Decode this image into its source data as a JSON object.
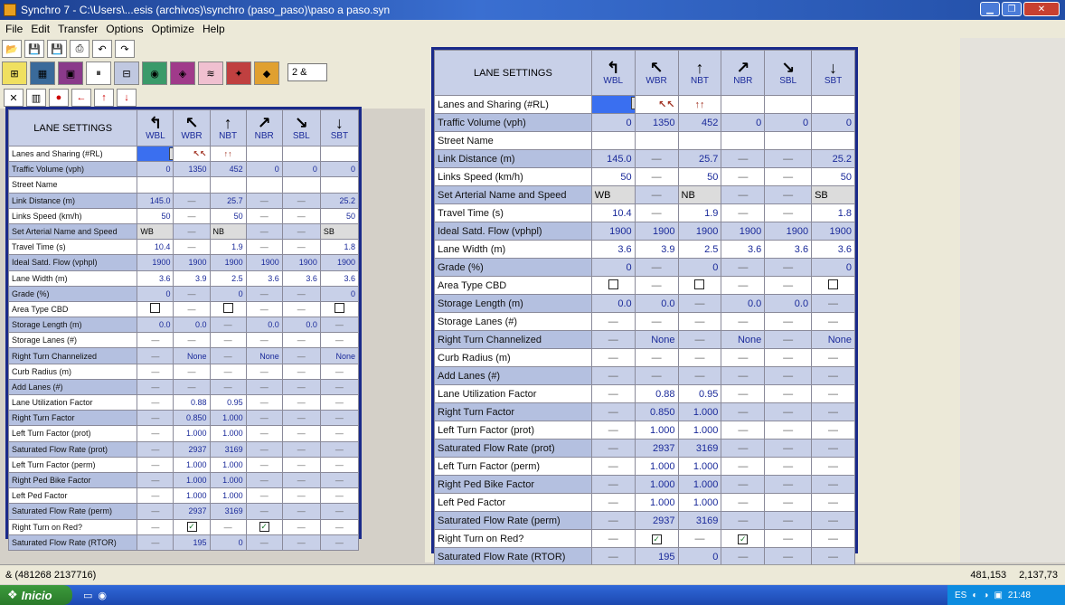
{
  "window": {
    "title": "Synchro 7 - C:\\Users\\...esis (archivos)\\synchro (paso_paso)\\paso a paso.syn",
    "controls": [
      "min-icon",
      "max-icon",
      "close-icon"
    ]
  },
  "menu": [
    "File",
    "Edit",
    "Transfer",
    "Options",
    "Optimize",
    "Help"
  ],
  "toolbar": {
    "zone_value": "2 &"
  },
  "lane_settings": {
    "header_label": "LANE SETTINGS",
    "movements": [
      {
        "code": "WBL",
        "arrow": "↰"
      },
      {
        "code": "WBR",
        "arrow": "↖"
      },
      {
        "code": "NBT",
        "arrow": "↑"
      },
      {
        "code": "NBR",
        "arrow": "↗"
      },
      {
        "code": "SBL",
        "arrow": "↘"
      },
      {
        "code": "SBT",
        "arrow": "↓"
      }
    ],
    "lanes_label": "Lanes and Sharing (#RL)",
    "wbr_lane_symbol": "↖↖",
    "nbt_lane_symbol": "↑↑",
    "rows": [
      {
        "label": "Traffic Volume (vph)",
        "values": [
          "0",
          "1350",
          "452",
          "0",
          "0",
          "0"
        ]
      },
      {
        "label": "Street Name",
        "values": [
          "",
          "",
          "",
          "",
          "",
          ""
        ]
      },
      {
        "label": "Link Distance (m)",
        "values": [
          "145.0",
          "—",
          "25.7",
          "—",
          "—",
          "25.2"
        ]
      },
      {
        "label": "Links Speed (km/h)",
        "values": [
          "50",
          "—",
          "50",
          "—",
          "—",
          "50"
        ]
      },
      {
        "label": "Set Arterial Name and Speed",
        "values": [
          "WB",
          "—",
          "NB",
          "—",
          "—",
          "SB"
        ]
      },
      {
        "label": "Travel Time (s)",
        "values": [
          "10.4",
          "—",
          "1.9",
          "—",
          "—",
          "1.8"
        ]
      },
      {
        "label": "Ideal Satd. Flow (vphpl)",
        "values": [
          "1900",
          "1900",
          "1900",
          "1900",
          "1900",
          "1900"
        ]
      },
      {
        "label": "Lane Width (m)",
        "values": [
          "3.6",
          "3.9",
          "2.5",
          "3.6",
          "3.6",
          "3.6"
        ]
      },
      {
        "label": "Grade (%)",
        "values": [
          "0",
          "—",
          "0",
          "—",
          "—",
          "0"
        ]
      },
      {
        "label": "Area Type CBD",
        "values": [
          "☐",
          "—",
          "☐",
          "—",
          "—",
          "☐"
        ]
      },
      {
        "label": "Storage Length (m)",
        "values": [
          "0.0",
          "0.0",
          "—",
          "0.0",
          "0.0",
          "—"
        ]
      },
      {
        "label": "Storage Lanes (#)",
        "values": [
          "—",
          "—",
          "—",
          "—",
          "—",
          "—"
        ]
      },
      {
        "label": "Right Turn Channelized",
        "values": [
          "—",
          "None",
          "—",
          "None",
          "—",
          "None"
        ]
      },
      {
        "label": "Curb Radius (m)",
        "values": [
          "—",
          "—",
          "—",
          "—",
          "—",
          "—"
        ]
      },
      {
        "label": "Add Lanes (#)",
        "values": [
          "—",
          "—",
          "—",
          "—",
          "—",
          "—"
        ]
      },
      {
        "label": "Lane Utilization Factor",
        "values": [
          "—",
          "0.88",
          "0.95",
          "—",
          "—",
          "—"
        ]
      },
      {
        "label": "Right Turn Factor",
        "values": [
          "—",
          "0.850",
          "1.000",
          "—",
          "—",
          "—"
        ]
      },
      {
        "label": "Left Turn Factor (prot)",
        "values": [
          "—",
          "1.000",
          "1.000",
          "—",
          "—",
          "—"
        ]
      },
      {
        "label": "Saturated Flow Rate (prot)",
        "values": [
          "—",
          "2937",
          "3169",
          "—",
          "—",
          "—"
        ]
      },
      {
        "label": "Left Turn Factor (perm)",
        "values": [
          "—",
          "1.000",
          "1.000",
          "—",
          "—",
          "—"
        ]
      },
      {
        "label": "Right Ped Bike Factor",
        "values": [
          "—",
          "1.000",
          "1.000",
          "—",
          "—",
          "—"
        ]
      },
      {
        "label": "Left Ped Factor",
        "values": [
          "—",
          "1.000",
          "1.000",
          "—",
          "—",
          "—"
        ]
      },
      {
        "label": "Saturated Flow Rate (perm)",
        "values": [
          "—",
          "2937",
          "3169",
          "—",
          "—",
          "—"
        ]
      },
      {
        "label": "Right Turn on Red?",
        "values": [
          "—",
          "☑",
          "—",
          "☑",
          "—",
          "—"
        ]
      },
      {
        "label": "Saturated Flow Rate (RTOR)",
        "values": [
          "—",
          "195",
          "0",
          "—",
          "—",
          "—"
        ]
      }
    ]
  },
  "status": {
    "left_text": "& (481268 2137716)",
    "x_coord": "481,153",
    "y_coord": "2,137,73"
  },
  "taskbar": {
    "start_label": "Inicio",
    "lang": "ES",
    "clock": "21:48"
  },
  "colors": {
    "panel_border": "#1a2a8a",
    "value_text": "#1a2a9a",
    "row_alt": "#c8d0e8",
    "lane_selected": "#3a6ff0"
  }
}
